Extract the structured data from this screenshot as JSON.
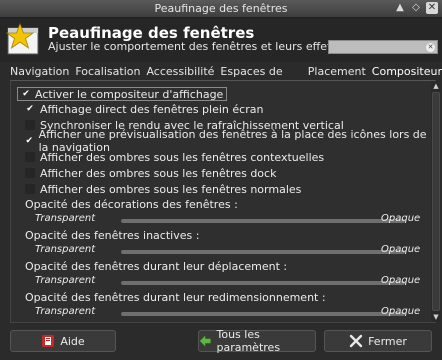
{
  "window": {
    "title": "Peaufinage des fenêtres"
  },
  "header": {
    "title": "Peaufinage des fenêtres",
    "subtitle": "Ajuster le comportement des fenêtres et leurs effets",
    "search_placeholder": ""
  },
  "tabs": [
    {
      "label": "Navigation"
    },
    {
      "label": "Focalisation"
    },
    {
      "label": "Accessibilité"
    },
    {
      "label": "Espaces de travail"
    },
    {
      "label": "Placement"
    },
    {
      "label": "Compositeur"
    }
  ],
  "compositor": {
    "enable": {
      "label": "Activer le compositeur d'affichage",
      "checked": true
    },
    "options": [
      {
        "label": "Affichage direct des fenêtres plein écran",
        "checked": true
      },
      {
        "label": "Synchroniser le rendu avec le rafraîchissement vertical",
        "checked": false
      },
      {
        "label": "Afficher une prévisualisation des fenêtres à la place des icônes lors de la navigation",
        "checked": true
      },
      {
        "label": "Afficher des ombres sous les fenêtres contextuelles",
        "checked": false
      },
      {
        "label": "Afficher des ombres sous les fenêtres dock",
        "checked": false
      },
      {
        "label": "Afficher des ombres sous les fenêtres normales",
        "checked": false
      }
    ],
    "sliders": [
      {
        "label": "Opacité des décorations des fenêtres :",
        "min": "Transparent",
        "max": "Opaque",
        "value": 1.0
      },
      {
        "label": "Opacité des fenêtres inactives :",
        "min": "Transparent",
        "max": "Opaque",
        "value": 1.0
      },
      {
        "label": "Opacité des fenêtres durant leur déplacement :",
        "min": "Transparent",
        "max": "Opaque",
        "value": 1.0
      },
      {
        "label": "Opacité des fenêtres durant leur redimensionnement :",
        "min": "Transparent",
        "max": "Opaque",
        "value": 1.0
      }
    ]
  },
  "buttons": {
    "help": "Aide",
    "all_settings": "Tous les paramètres",
    "close": "Fermer"
  },
  "colors": {
    "background": "#2b2b2b",
    "accent_green": "#5cb83a",
    "close_icon": "#e8e8e8"
  }
}
